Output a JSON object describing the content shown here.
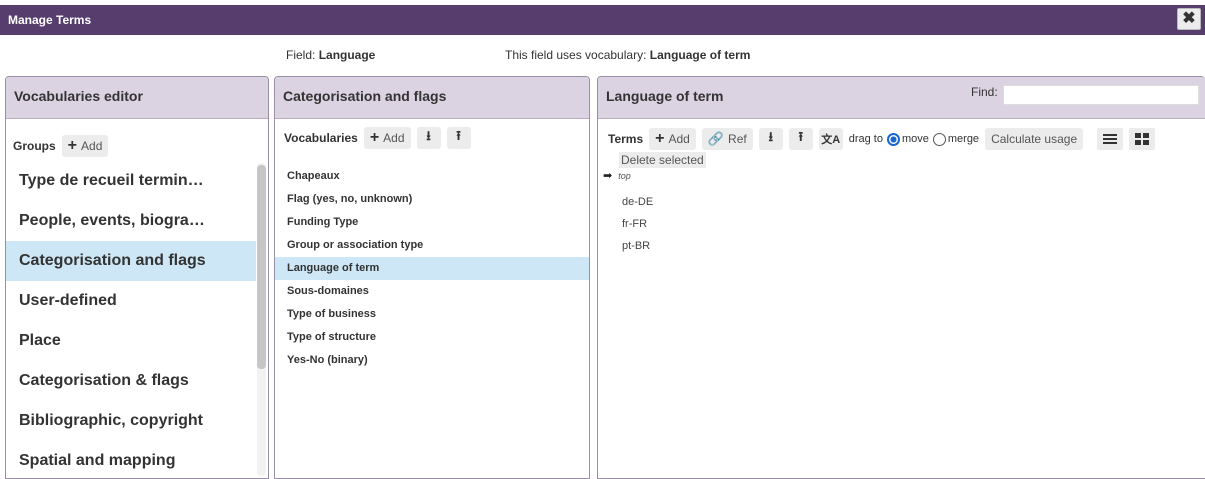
{
  "window": {
    "title": "Manage Terms",
    "close_icon": "close-icon"
  },
  "field_info": {
    "field_label": "Field: ",
    "field_value": "Language",
    "vocab_label": "This field uses vocabulary: ",
    "vocab_value": "Language of term"
  },
  "groups_panel": {
    "title": "Vocabularies editor",
    "toolbar_label": "Groups",
    "add_label": "Add",
    "items": [
      "Type de recueil termin…",
      "People, events, biogra…",
      "Categorisation and flags",
      "User-defined",
      "Place",
      "Categorisation & flags",
      "Bibliographic, copyright",
      "Spatial and mapping"
    ],
    "selected_index": 2
  },
  "vocab_panel": {
    "title": "Categorisation and flags",
    "toolbar_label": "Vocabularies",
    "add_label": "Add",
    "items": [
      "Chapeaux",
      "Flag (yes, no, unknown)",
      "Funding Type",
      "Group or association type",
      "Language of term",
      "Sous-domaines",
      "Type of business",
      "Type of structure",
      "Yes-No (binary)"
    ],
    "selected_index": 4
  },
  "terms_panel": {
    "title": "Language of term",
    "find_label": "Find:",
    "find_value": "",
    "toolbar_label": "Terms",
    "add_label": "Add",
    "ref_label": "Ref",
    "drag_to_label": "drag to",
    "move_label": "move",
    "merge_label": "merge",
    "drag_mode": "move",
    "calc_label": "Calculate usage",
    "delete_label": "Delete selected",
    "top_label": "top",
    "terms": [
      "de-DE",
      "fr-FR",
      "pt-BR"
    ]
  },
  "colors": {
    "titlebar": "#563d6e",
    "panel_header": "#dcd3e2",
    "selected": "#cde7f6",
    "radio": "#1a66d0"
  }
}
